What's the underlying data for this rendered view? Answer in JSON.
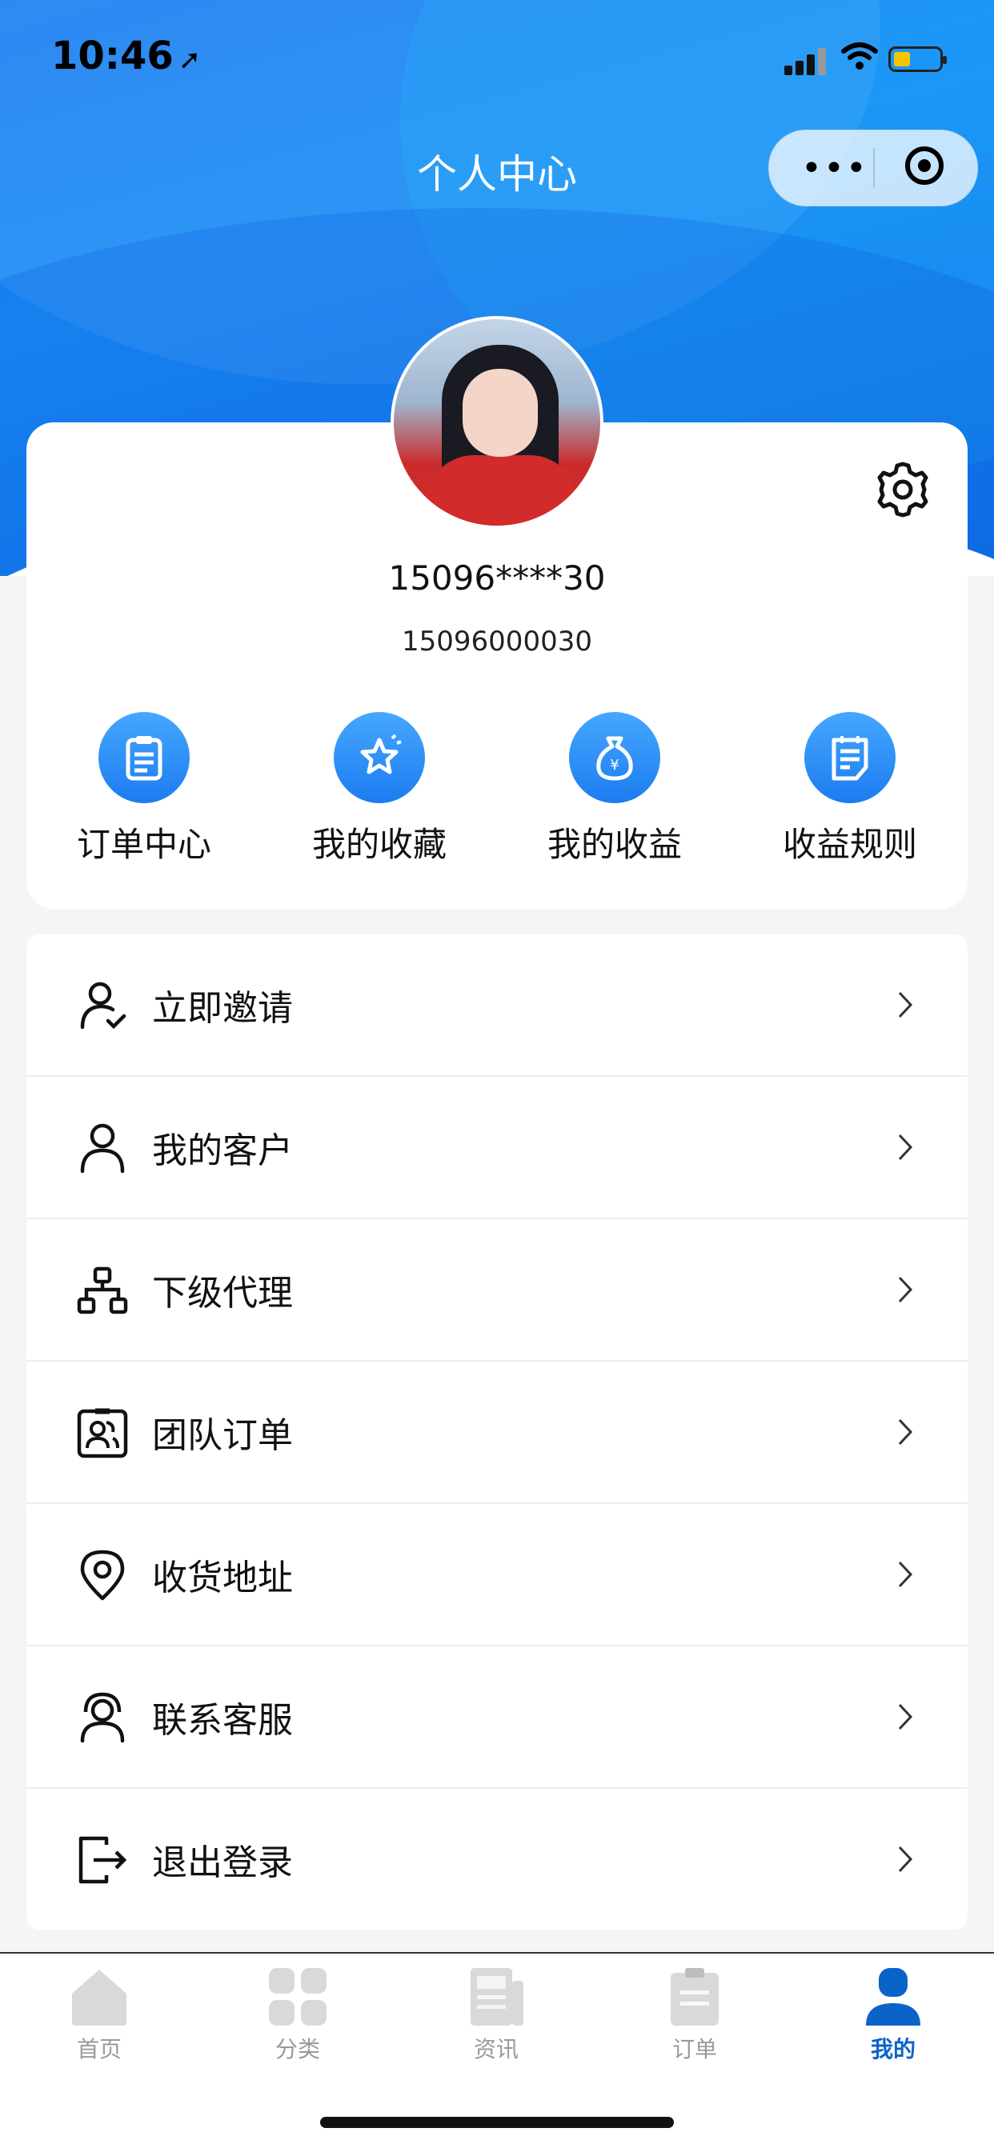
{
  "status_bar": {
    "time": "10:46"
  },
  "nav": {
    "title": "个人中心",
    "more_icon": "more-dots-icon",
    "close_icon": "target-icon"
  },
  "profile": {
    "masked_phone": "15096****30",
    "full_phone": "15096000030",
    "settings_icon": "gear-icon"
  },
  "quick_actions": [
    {
      "label": "订单中心",
      "icon": "clipboard-icon"
    },
    {
      "label": "我的收藏",
      "icon": "star-icon"
    },
    {
      "label": "我的收益",
      "icon": "money-bag-icon"
    },
    {
      "label": "收益规则",
      "icon": "notepad-icon"
    }
  ],
  "menu": [
    {
      "label": "立即邀请",
      "icon": "invite-user-icon"
    },
    {
      "label": "我的客户",
      "icon": "user-icon"
    },
    {
      "label": "下级代理",
      "icon": "hierarchy-icon"
    },
    {
      "label": "团队订单",
      "icon": "team-badge-icon"
    },
    {
      "label": "收货地址",
      "icon": "location-pin-icon"
    },
    {
      "label": "联系客服",
      "icon": "support-agent-icon"
    },
    {
      "label": "退出登录",
      "icon": "logout-icon"
    }
  ],
  "tabbar": [
    {
      "label": "首页",
      "icon": "home-icon"
    },
    {
      "label": "分类",
      "icon": "grid-icon"
    },
    {
      "label": "资讯",
      "icon": "news-icon"
    },
    {
      "label": "订单",
      "icon": "order-icon"
    },
    {
      "label": "我的",
      "icon": "profile-icon",
      "active": true
    }
  ],
  "colors": {
    "brand_blue": "#1c7cf0",
    "active_tab": "#0a63c9",
    "inactive_tab": "#9a9a9a"
  }
}
